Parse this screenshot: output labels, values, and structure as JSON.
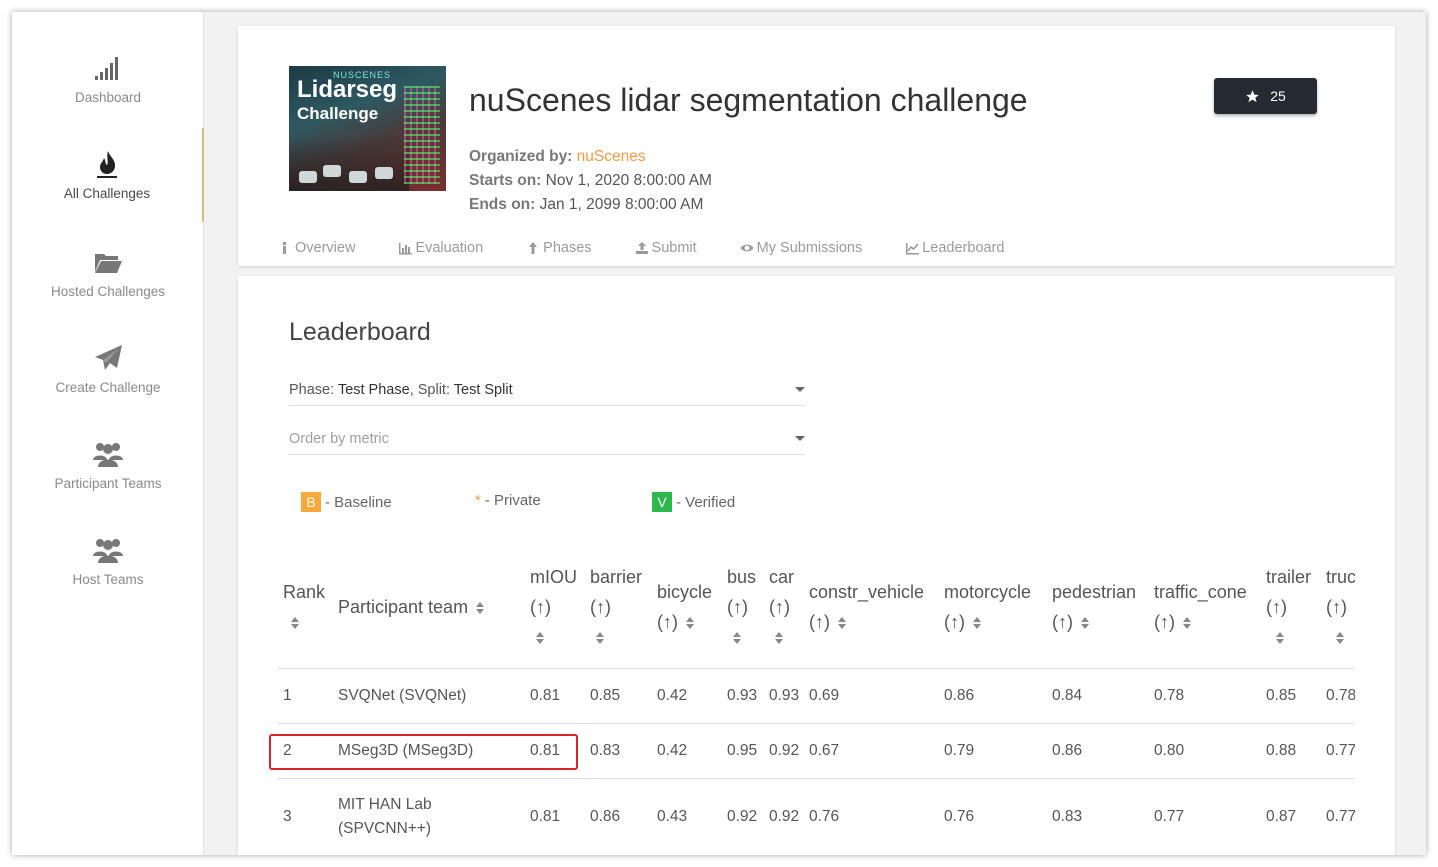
{
  "sidebar": {
    "items": [
      {
        "label": "Dashboard",
        "icon": "signal-bars-icon"
      },
      {
        "label": "All Challenges",
        "icon": "flame-icon"
      },
      {
        "label": "Hosted Challenges",
        "icon": "folder-open-icon"
      },
      {
        "label": "Create Challenge",
        "icon": "paper-plane-icon"
      },
      {
        "label": "Participant Teams",
        "icon": "users-icon"
      },
      {
        "label": "Host Teams",
        "icon": "users-icon"
      }
    ],
    "active": "All Challenges"
  },
  "challenge": {
    "thumbnail": {
      "line0": "NUSCENES",
      "line1": "Lidarseg",
      "line2": "Challenge"
    },
    "title": "nuScenes lidar segmentation challenge",
    "organized_label": "Organized by:",
    "organizer": "nuScenes",
    "starts_label": "Starts on:",
    "starts": "Nov 1, 2020 8:00:00 AM",
    "ends_label": "Ends on:",
    "ends": "Jan 1, 2099 8:00:00 AM",
    "stars": "25"
  },
  "tabs": [
    {
      "label": "Overview",
      "icon": "info-icon"
    },
    {
      "label": "Evaluation",
      "icon": "bar-chart-icon"
    },
    {
      "label": "Phases",
      "icon": "upload-arrow-icon"
    },
    {
      "label": "Submit",
      "icon": "upload-icon"
    },
    {
      "label": "My Submissions",
      "icon": "eye-icon"
    },
    {
      "label": "Leaderboard",
      "icon": "line-chart-icon"
    }
  ],
  "leaderboard": {
    "title": "Leaderboard",
    "phase_label": "Phase:",
    "phase_value": "Test Phase",
    "split_label": ", Split:",
    "split_value": "Test Split",
    "order_placeholder": "Order by metric",
    "legend": {
      "baseline_badge": "B",
      "baseline_text": "- Baseline",
      "private_mark": "*",
      "private_text": "- Private",
      "verified_badge": "V",
      "verified_text": "- Verified"
    },
    "columns": [
      "Rank",
      "Participant team",
      "mIOU (↑)",
      "barrier (↑)",
      "bicycle (↑)",
      "bus (↑)",
      "car (↑)",
      "constr_vehicle (↑)",
      "motorcycle (↑)",
      "pedestrian (↑)",
      "traffic_cone (↑)",
      "trailer (↑)",
      "truck (↑)"
    ],
    "rows": [
      {
        "rank": "1",
        "team": "SVQNet (SVQNet)",
        "vals": [
          "0.81",
          "0.85",
          "0.42",
          "0.93",
          "0.93",
          "0.69",
          "0.86",
          "0.84",
          "0.78",
          "0.85",
          "0.78"
        ]
      },
      {
        "rank": "2",
        "team": "MSeg3D (MSeg3D)",
        "vals": [
          "0.81",
          "0.83",
          "0.42",
          "0.95",
          "0.92",
          "0.67",
          "0.79",
          "0.86",
          "0.80",
          "0.88",
          "0.77"
        ]
      },
      {
        "rank": "3",
        "team": "MIT HAN Lab (SPVCNN++)",
        "vals": [
          "0.81",
          "0.86",
          "0.43",
          "0.92",
          "0.92",
          "0.76",
          "0.76",
          "0.83",
          "0.77",
          "0.87",
          "0.77"
        ]
      }
    ]
  }
}
